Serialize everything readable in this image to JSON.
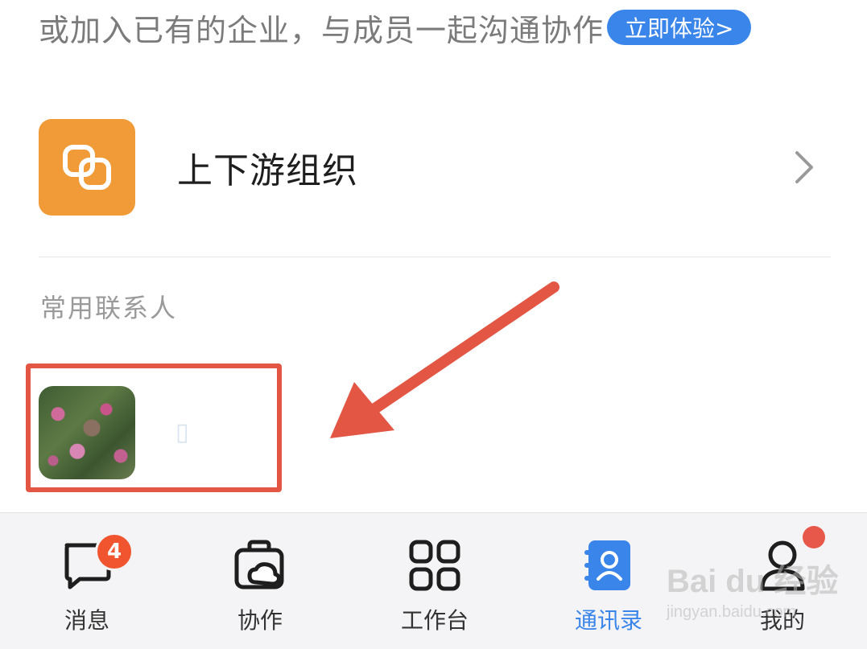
{
  "banner": {
    "text": "或加入已有的企业，与成员一起沟通协作",
    "button_label": "立即体验>"
  },
  "org_row": {
    "label": "上下游组织",
    "icon": "link-icon",
    "icon_color": "#f19b38"
  },
  "section": {
    "title": "常用联系人"
  },
  "contact": {
    "name": "▯"
  },
  "tabs": [
    {
      "label": "消息",
      "icon": "chat-bubble-icon",
      "badge": "4",
      "active": false
    },
    {
      "label": "协作",
      "icon": "cloud-briefcase-icon",
      "active": false
    },
    {
      "label": "工作台",
      "icon": "grid-icon",
      "active": false
    },
    {
      "label": "通讯录",
      "icon": "contacts-book-icon",
      "active": true
    },
    {
      "label": "我的",
      "icon": "person-icon",
      "active": false
    }
  ],
  "watermark": {
    "line1": "Bai du 经验",
    "line2": "jingyan.baidu.com"
  },
  "colors": {
    "accent": "#3a85ea",
    "annotation": "#e25643",
    "badge": "#f0552f"
  }
}
